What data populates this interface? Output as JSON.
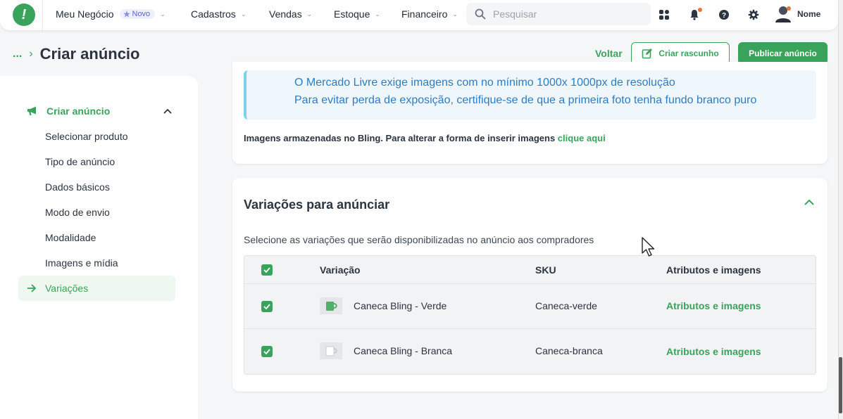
{
  "topnav": {
    "business": "Meu Negócio",
    "badge": "Novo",
    "items": [
      {
        "label": "Cadastros"
      },
      {
        "label": "Vendas"
      },
      {
        "label": "Estoque"
      },
      {
        "label": "Financeiro"
      }
    ],
    "search_placeholder": "Pesquisar",
    "user_name": "Nome"
  },
  "header": {
    "breadcrumb_more": "...",
    "title": "Criar anúncio",
    "back_label": "Voltar",
    "draft_label": "Criar rascunho",
    "publish_label": "Publicar anúncio"
  },
  "sidebar": {
    "section": "Criar anúncio",
    "items": [
      {
        "label": "Selecionar produto"
      },
      {
        "label": "Tipo de anúncio"
      },
      {
        "label": "Dados básicos"
      },
      {
        "label": "Modo de envio"
      },
      {
        "label": "Modalidade"
      },
      {
        "label": "Imagens e mídia"
      }
    ],
    "active": "Variações"
  },
  "images_card": {
    "info_line1": "O Mercado Livre exige imagens com no mínimo 1000x 1000px de resolução",
    "info_line2": "Para evitar perda de exposição, certifique-se de que a primeira foto tenha fundo branco puro",
    "stored_text": "Imagens armazenadas no Bling. Para alterar a forma de inserir imagens",
    "stored_link": "clique aqui"
  },
  "variations_card": {
    "title": "Variações para anúnciar",
    "description": "Selecione as variações que serão disponibilizadas no anúncio aos compradores",
    "columns": {
      "variation": "Variação",
      "sku": "SKU",
      "attributes": "Atributos e imagens"
    },
    "rows": [
      {
        "name": "Caneca Bling - Verde",
        "sku": "Caneca-verde",
        "action": "Atributos e imagens",
        "checked": true
      },
      {
        "name": "Caneca Bling - Branca",
        "sku": "Caneca-branca",
        "action": "Atributos e imagens",
        "checked": true
      }
    ]
  },
  "colors": {
    "brand": "#3aa35b",
    "info_text": "#2f7cc4",
    "notification": "#e8733a"
  }
}
